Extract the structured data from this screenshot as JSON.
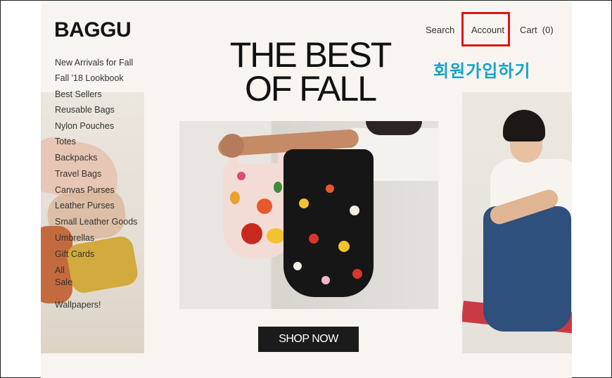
{
  "brand": {
    "logo_text": "BAGGU"
  },
  "top_nav": {
    "search": "Search",
    "account": "Account",
    "cart": "Cart  (0)"
  },
  "annotation": {
    "korean_label": "회원가입하기",
    "highlight_color": "#e01515",
    "label_color": "#18a2c4"
  },
  "hero": {
    "headline_line1": "THE BEST",
    "headline_line2": "OF FALL",
    "cta_label": "SHOP NOW"
  },
  "menu": {
    "items": [
      "New Arrivals for Fall",
      "Fall '18 Lookbook",
      "Best Sellers",
      "Reusable Bags",
      "Nylon Pouches",
      "Totes",
      "Backpacks",
      "Travel Bags",
      "Canvas Purses",
      "Leather Purses",
      "Small Leather Goods",
      "Umbrellas",
      "Gift Cards",
      "All",
      "Sale",
      "Wallpapers!"
    ]
  },
  "images": {
    "left": "product-photo-bags-stack",
    "center": "product-photo-arm-holding-floral-bags",
    "right": "product-photo-person-with-denim-bag"
  }
}
